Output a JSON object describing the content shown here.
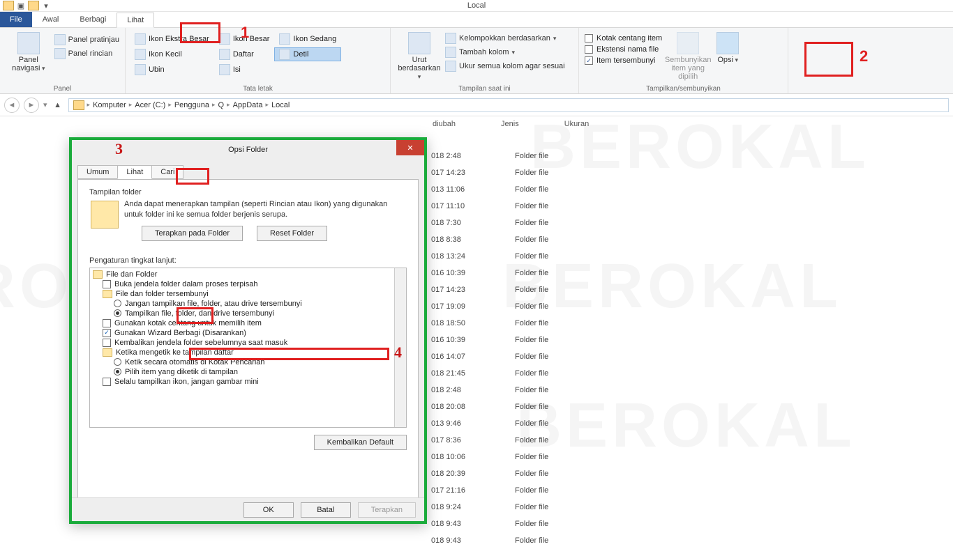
{
  "window": {
    "title": "Local"
  },
  "ribbon_tabs": {
    "file": "File",
    "awal": "Awal",
    "berbagi": "Berbagi",
    "lihat": "Lihat"
  },
  "ribbon": {
    "panel": {
      "nav": "Panel navigasi",
      "preview": "Panel pratinjau",
      "details": "Panel rincian",
      "group": "Panel"
    },
    "layout": {
      "xl": "Ikon Ekstra Besar",
      "l": "Ikon Besar",
      "m": "Ikon Sedang",
      "s": "Ikon Kecil",
      "list": "Daftar",
      "detail": "Detil",
      "tiles": "Ubin",
      "content": "Isi",
      "group": "Tata letak"
    },
    "cur": {
      "sort": "Urut berdasarkan",
      "groupby": "Kelompokkan berdasarkan",
      "addcol": "Tambah kolom",
      "fit": "Ukur semua kolom agar sesuai",
      "group": "Tampilan saat ini"
    },
    "show": {
      "chk_boxes": "Kotak centang item",
      "chk_ext": "Ekstensi nama file",
      "chk_hidden": "Item tersembunyi",
      "hide": "Sembunyikan item yang dipilih",
      "opts": "Opsi",
      "group": "Tampilkan/sembunyikan"
    }
  },
  "breadcrumb": [
    "Komputer",
    "Acer (C:)",
    "Pengguna",
    "Q",
    "AppData",
    "Local"
  ],
  "columns": {
    "date": "diubah",
    "type": "Jenis",
    "size": "Ukuran"
  },
  "rows": [
    {
      "date": "018 2:48",
      "type": "Folder file"
    },
    {
      "date": "017 14:23",
      "type": "Folder file"
    },
    {
      "date": "013 11:06",
      "type": "Folder file"
    },
    {
      "date": "017 11:10",
      "type": "Folder file"
    },
    {
      "date": "018 7:30",
      "type": "Folder file"
    },
    {
      "date": "018 8:38",
      "type": "Folder file"
    },
    {
      "date": "018 13:24",
      "type": "Folder file"
    },
    {
      "date": "016 10:39",
      "type": "Folder file"
    },
    {
      "date": "017 14:23",
      "type": "Folder file"
    },
    {
      "date": "017 19:09",
      "type": "Folder file"
    },
    {
      "date": "018 18:50",
      "type": "Folder file"
    },
    {
      "date": "016 10:39",
      "type": "Folder file"
    },
    {
      "date": "016 14:07",
      "type": "Folder file"
    },
    {
      "date": "018 21:45",
      "type": "Folder file"
    },
    {
      "date": "018 2:48",
      "type": "Folder file"
    },
    {
      "date": "018 20:08",
      "type": "Folder file"
    },
    {
      "date": "013 9:46",
      "type": "Folder file"
    },
    {
      "date": "017 8:36",
      "type": "Folder file"
    },
    {
      "date": "018 10:06",
      "type": "Folder file"
    },
    {
      "date": "018 20:39",
      "type": "Folder file"
    },
    {
      "date": "017 21:16",
      "type": "Folder file"
    },
    {
      "date": "018 9:24",
      "type": "Folder file"
    },
    {
      "date": "018 9:43",
      "type": "Folder file"
    },
    {
      "date": "018 9:43",
      "type": "Folder file"
    }
  ],
  "dialog": {
    "title": "Opsi Folder",
    "tabs": {
      "umum": "Umum",
      "lihat": "Lihat",
      "cari": "Cari"
    },
    "section_view": "Tampilan folder",
    "section_desc": "Anda dapat menerapkan tampilan (seperti Rincian atau Ikon) yang digunakan untuk folder ini ke semua folder berjenis serupa.",
    "btn_apply_folders": "Terapkan pada Folder",
    "btn_reset_folders": "Reset Folder",
    "adv_label": "Pengaturan tingkat lanjut:",
    "tree": {
      "root": "File dan Folder",
      "open_sep": "Buka jendela folder dalam proses terpisah",
      "hidden_group": "File dan folder tersembunyi",
      "dont_show": "Jangan tampilkan file, folder, atau drive tersembunyi",
      "show": "Tampilkan file, folder, dan drive tersembunyi",
      "use_check": "Gunakan kotak centang untuk memilih item",
      "use_wizard": "Gunakan Wizard Berbagi (Disarankan)",
      "restore_prev": "Kembalikan jendela folder sebelumnya saat masuk",
      "typing_group": "Ketika mengetik ke tampilan daftar",
      "auto_search": "Ketik secara otomatis di Kotak Pencarian",
      "select_typed": "Pilih item yang diketik di tampilan",
      "always_icons": "Selalu tampilkan ikon, jangan gambar mini"
    },
    "btn_restore": "Kembalikan Default",
    "btn_ok": "OK",
    "btn_cancel": "Batal",
    "btn_apply": "Terapkan"
  },
  "annotations": {
    "n1": "1",
    "n2": "2",
    "n3": "3",
    "n4": "4"
  },
  "watermark": "BEROKAL"
}
